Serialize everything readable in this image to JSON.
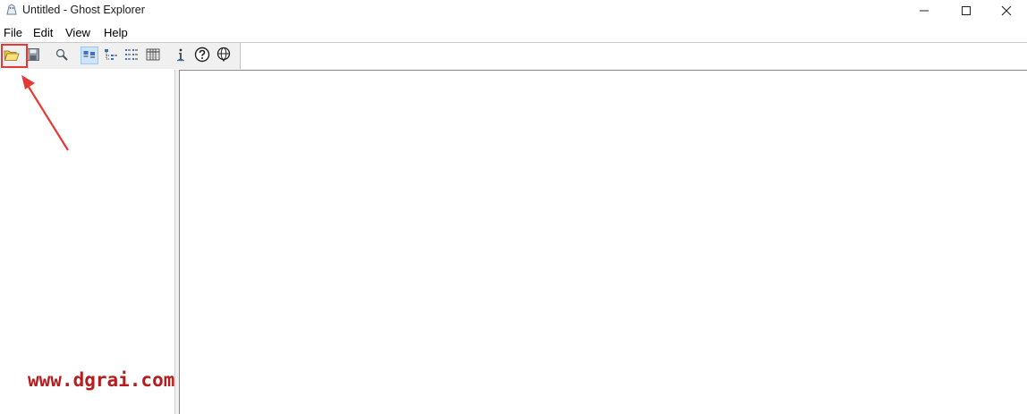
{
  "window": {
    "title": "Untitled - Ghost Explorer",
    "controls": {
      "minimize": "—",
      "maximize": "☐",
      "close": "✕"
    }
  },
  "menubar": {
    "items": [
      {
        "label": "File"
      },
      {
        "label": "Edit"
      },
      {
        "label": "View"
      },
      {
        "label": "Help"
      }
    ]
  },
  "toolbar": {
    "buttons": [
      {
        "icon": "open-folder-icon",
        "highlighted": true
      },
      {
        "icon": "save-disk-icon"
      },
      {
        "icon": "find-icon"
      },
      {
        "icon": "large-icons-view-icon",
        "selected": true
      },
      {
        "icon": "tree-view-icon"
      },
      {
        "icon": "list-view-icon"
      },
      {
        "icon": "details-view-icon"
      },
      {
        "icon": "info-icon"
      },
      {
        "icon": "help-icon"
      },
      {
        "icon": "web-icon"
      }
    ]
  },
  "annotation": {
    "arrow_color": "#e53935",
    "highlight_color": "#e53935"
  },
  "watermark": {
    "text": "www.dgrai.com",
    "color": "#b71c1c"
  }
}
